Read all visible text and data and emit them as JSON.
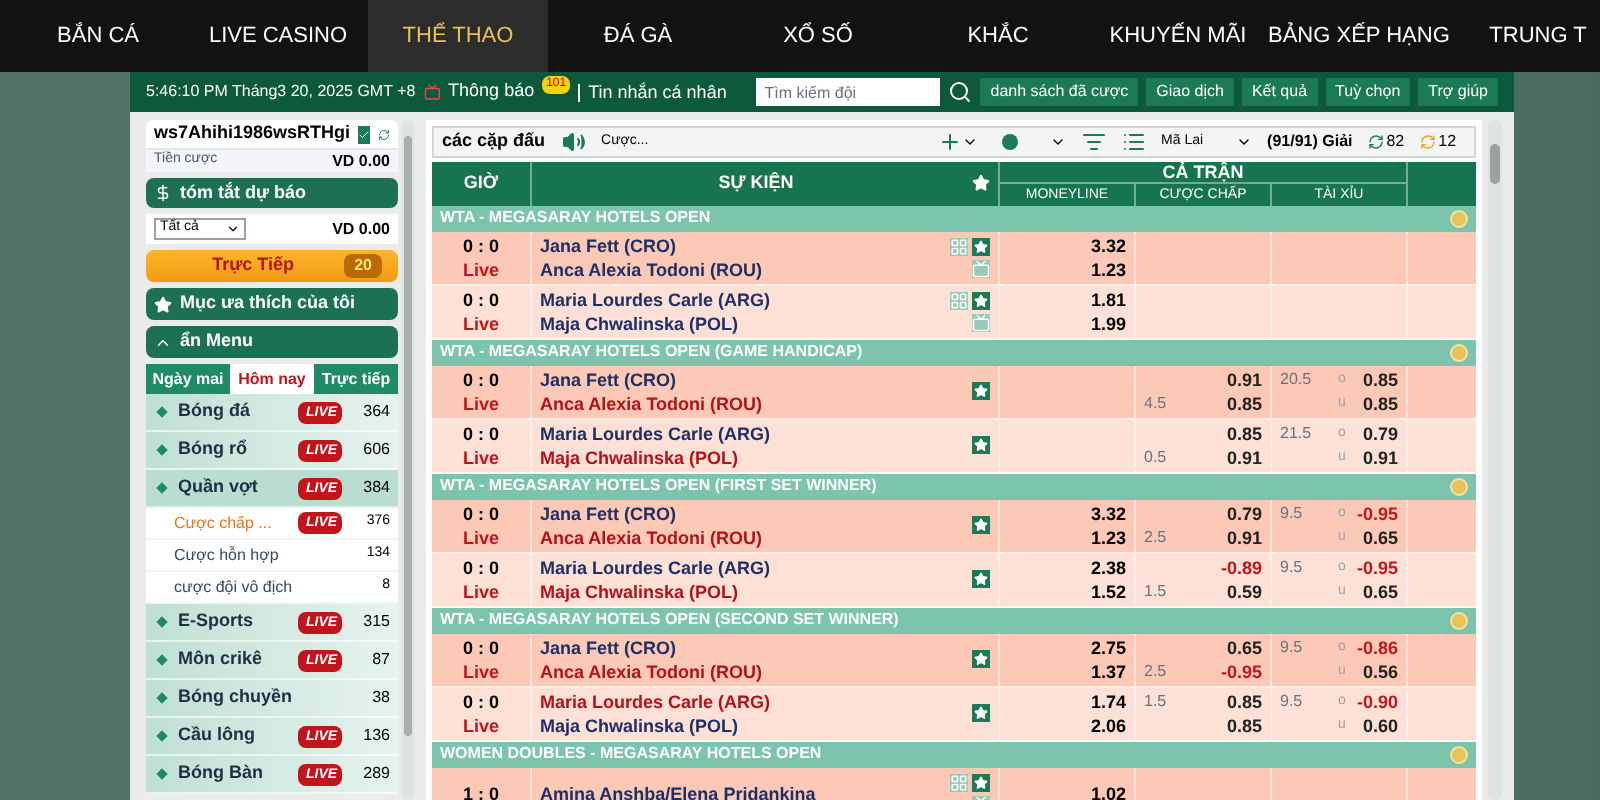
{
  "nav": {
    "items": [
      {
        "label": "BẮN CÁ",
        "selected": false
      },
      {
        "label": "LIVE CASINO",
        "selected": false
      },
      {
        "label": "THỂ THAO",
        "selected": true
      },
      {
        "label": "ĐÁ GÀ",
        "selected": false
      },
      {
        "label": "XỔ SỐ",
        "selected": false
      },
      {
        "label": "KHẮC",
        "selected": false
      },
      {
        "label": "KHUYẾN MÃI",
        "selected": false
      },
      {
        "label": "BẢNG XẾP HẠNG",
        "selected": false
      },
      {
        "label": "TRUNG T",
        "selected": false
      }
    ]
  },
  "header_bar": {
    "datetime": "5:46:10 PM Tháng3 20, 2025 GMT +8",
    "notice": {
      "label": "Thông báo",
      "badge": "101"
    },
    "messages": "Tin nhắn cá nhân",
    "search": {
      "placeholder": "Tìm kiếm đội"
    },
    "buttons": [
      "danh sách đã cược",
      "Giao dịch",
      "Kết quả",
      "Tuỳ chọn",
      "Trợ giúp"
    ]
  },
  "sidebar": {
    "account": {
      "username": "ws7Ahihi1986wsRTHgi",
      "stake_label": "Tiền cược",
      "stake": "VD 0.00"
    },
    "summary": {
      "title": "tóm tắt dự báo",
      "filter": "Tất cả",
      "amount": "VD 0.00"
    },
    "live_button": {
      "label": "Trực Tiếp",
      "count": "20"
    },
    "favorites": "Mục ưa thích của tôi",
    "menu": {
      "title": "ẩn Menu",
      "expanded": true
    },
    "tabs": [
      {
        "label": "Ngày mai",
        "selected": false
      },
      {
        "label": "Hôm nay",
        "selected": true
      },
      {
        "label": "Trực tiếp",
        "selected": false
      }
    ],
    "sports": [
      {
        "name": "Bóng đá",
        "badge": "LIVE",
        "count": "364",
        "expanded": false
      },
      {
        "name": "Bóng rổ",
        "badge": "LIVE",
        "count": "606",
        "expanded": false
      },
      {
        "name": "Quần vợt",
        "badge": "LIVE",
        "count": "384",
        "expanded": true,
        "children": [
          {
            "name": "Cược chấp ...",
            "badge": "LIVE",
            "count": "376",
            "selected": true
          },
          {
            "name": "Cược hỗn hợp",
            "count": "134",
            "selected": false
          },
          {
            "name": "cược đội vô địch",
            "count": "8",
            "selected": false
          }
        ]
      },
      {
        "name": "E-Sports",
        "badge": "LIVE",
        "count": "315",
        "expanded": false
      },
      {
        "name": "Môn crikê",
        "badge": "LIVE",
        "count": "87",
        "expanded": false
      },
      {
        "name": "Bóng chuyền",
        "count": "38",
        "expanded": false
      },
      {
        "name": "Cầu lông",
        "badge": "LIVE",
        "count": "136",
        "expanded": false
      },
      {
        "name": "Bóng Bàn",
        "badge": "LIVE",
        "count": "289",
        "expanded": false
      }
    ]
  },
  "toolbar": {
    "title": "các cặp đấu",
    "bet_filter": "Cược...",
    "region": "Mã Lai",
    "leagues": "(91/91) Giải",
    "refresh_counts": [
      "82",
      "12"
    ]
  },
  "table": {
    "columns": {
      "time": "GIỜ",
      "event": "SỰ KIỆN",
      "full_match": "CẢ TRẬN",
      "moneyline": "MONEYLINE",
      "handicap": "CƯỢC CHẤP",
      "total": "TÀI XỈU"
    },
    "groups": [
      {
        "title": "WTA - MEGASARAY HOTELS OPEN",
        "rows": [
          {
            "score": "0 : 0",
            "status": "Live",
            "stats": true,
            "teams": [
              {
                "name": "Jana Fett (CRO)",
                "favored": false
              },
              {
                "name": "Anca Alexia Todoni (ROU)",
                "favored": false
              }
            ],
            "moneyline": [
              "3.32",
              "1.23"
            ]
          },
          {
            "score": "0 : 0",
            "status": "Live",
            "stats": true,
            "teams": [
              {
                "name": "Maria Lourdes Carle (ARG)",
                "favored": false
              },
              {
                "name": "Maja Chwalinska (POL)",
                "favored": false
              }
            ],
            "moneyline": [
              "1.81",
              "1.99"
            ]
          }
        ]
      },
      {
        "title": "WTA - MEGASARAY HOTELS OPEN (GAME HANDICAP)",
        "rows": [
          {
            "score": "0 : 0",
            "status": "Live",
            "stats": false,
            "teams": [
              {
                "name": "Jana Fett (CRO)",
                "favored": false
              },
              {
                "name": "Anca Alexia Todoni (ROU)",
                "favored": true
              }
            ],
            "handicap": [
              {
                "value": "0.91",
                "negative": false
              },
              {
                "line": "4.5",
                "value": "0.85",
                "negative": false
              }
            ],
            "total": {
              "line": "20.5",
              "labels": [
                "o",
                "u"
              ],
              "odds": [
                {
                  "value": "0.85",
                  "negative": false
                },
                {
                  "value": "0.85",
                  "negative": false
                }
              ]
            }
          },
          {
            "score": "0 : 0",
            "status": "Live",
            "stats": false,
            "teams": [
              {
                "name": "Maria Lourdes Carle (ARG)",
                "favored": false
              },
              {
                "name": "Maja Chwalinska (POL)",
                "favored": true
              }
            ],
            "handicap": [
              {
                "value": "0.85",
                "negative": false
              },
              {
                "line": "0.5",
                "value": "0.91",
                "negative": false
              }
            ],
            "total": {
              "line": "21.5",
              "labels": [
                "o",
                "u"
              ],
              "odds": [
                {
                  "value": "0.79",
                  "negative": false
                },
                {
                  "value": "0.91",
                  "negative": false
                }
              ]
            }
          }
        ]
      },
      {
        "title": "WTA - MEGASARAY HOTELS OPEN (FIRST SET WINNER)",
        "rows": [
          {
            "score": "0 : 0",
            "status": "Live",
            "stats": false,
            "teams": [
              {
                "name": "Jana Fett (CRO)",
                "favored": false
              },
              {
                "name": "Anca Alexia Todoni (ROU)",
                "favored": true
              }
            ],
            "moneyline": [
              "3.32",
              "1.23"
            ],
            "handicap": [
              {
                "value": "0.79",
                "negative": false
              },
              {
                "line": "2.5",
                "value": "0.91",
                "negative": false
              }
            ],
            "total": {
              "line": "9.5",
              "labels": [
                "o",
                "u"
              ],
              "odds": [
                {
                  "value": "-0.95",
                  "negative": true
                },
                {
                  "value": "0.65",
                  "negative": false
                }
              ]
            }
          },
          {
            "score": "0 : 0",
            "status": "Live",
            "stats": false,
            "teams": [
              {
                "name": "Maria Lourdes Carle (ARG)",
                "favored": false
              },
              {
                "name": "Maja Chwalinska (POL)",
                "favored": true
              }
            ],
            "moneyline": [
              "2.38",
              "1.52"
            ],
            "handicap": [
              {
                "value": "-0.89",
                "negative": true
              },
              {
                "line": "1.5",
                "value": "0.59",
                "negative": false
              }
            ],
            "total": {
              "line": "9.5",
              "labels": [
                "o",
                "u"
              ],
              "odds": [
                {
                  "value": "-0.95",
                  "negative": true
                },
                {
                  "value": "0.65",
                  "negative": false
                }
              ]
            }
          }
        ]
      },
      {
        "title": "WTA - MEGASARAY HOTELS OPEN (SECOND SET WINNER)",
        "rows": [
          {
            "score": "0 : 0",
            "status": "Live",
            "stats": false,
            "teams": [
              {
                "name": "Jana Fett (CRO)",
                "favored": false
              },
              {
                "name": "Anca Alexia Todoni (ROU)",
                "favored": true
              }
            ],
            "moneyline": [
              "2.75",
              "1.37"
            ],
            "handicap": [
              {
                "value": "0.65",
                "negative": false
              },
              {
                "line": "2.5",
                "value": "-0.95",
                "negative": true
              }
            ],
            "total": {
              "line": "9.5",
              "labels": [
                "o",
                "u"
              ],
              "odds": [
                {
                  "value": "-0.86",
                  "negative": true
                },
                {
                  "value": "0.56",
                  "negative": false
                }
              ]
            }
          },
          {
            "score": "0 : 0",
            "status": "Live",
            "stats": false,
            "teams": [
              {
                "name": "Maria Lourdes Carle (ARG)",
                "favored": true
              },
              {
                "name": "Maja Chwalinska (POL)",
                "favored": false
              }
            ],
            "moneyline": [
              "1.74",
              "2.06"
            ],
            "handicap": [
              {
                "line": "1.5",
                "value": "0.85",
                "negative": false
              },
              {
                "value": "0.85",
                "negative": false
              }
            ],
            "total": {
              "line": "9.5",
              "labels": [
                "o",
                "u"
              ],
              "odds": [
                {
                  "value": "-0.90",
                  "negative": true
                },
                {
                  "value": "0.60",
                  "negative": false
                }
              ]
            }
          }
        ]
      },
      {
        "title": "WOMEN DOUBLES - MEGASARAY HOTELS OPEN",
        "rows": [
          {
            "score": "1 : 0",
            "stats": true,
            "teams": [
              {
                "name": "Amina Anshba/Elena Pridankina",
                "favored": false
              }
            ],
            "moneyline": [
              "1.02"
            ]
          }
        ]
      }
    ]
  }
}
